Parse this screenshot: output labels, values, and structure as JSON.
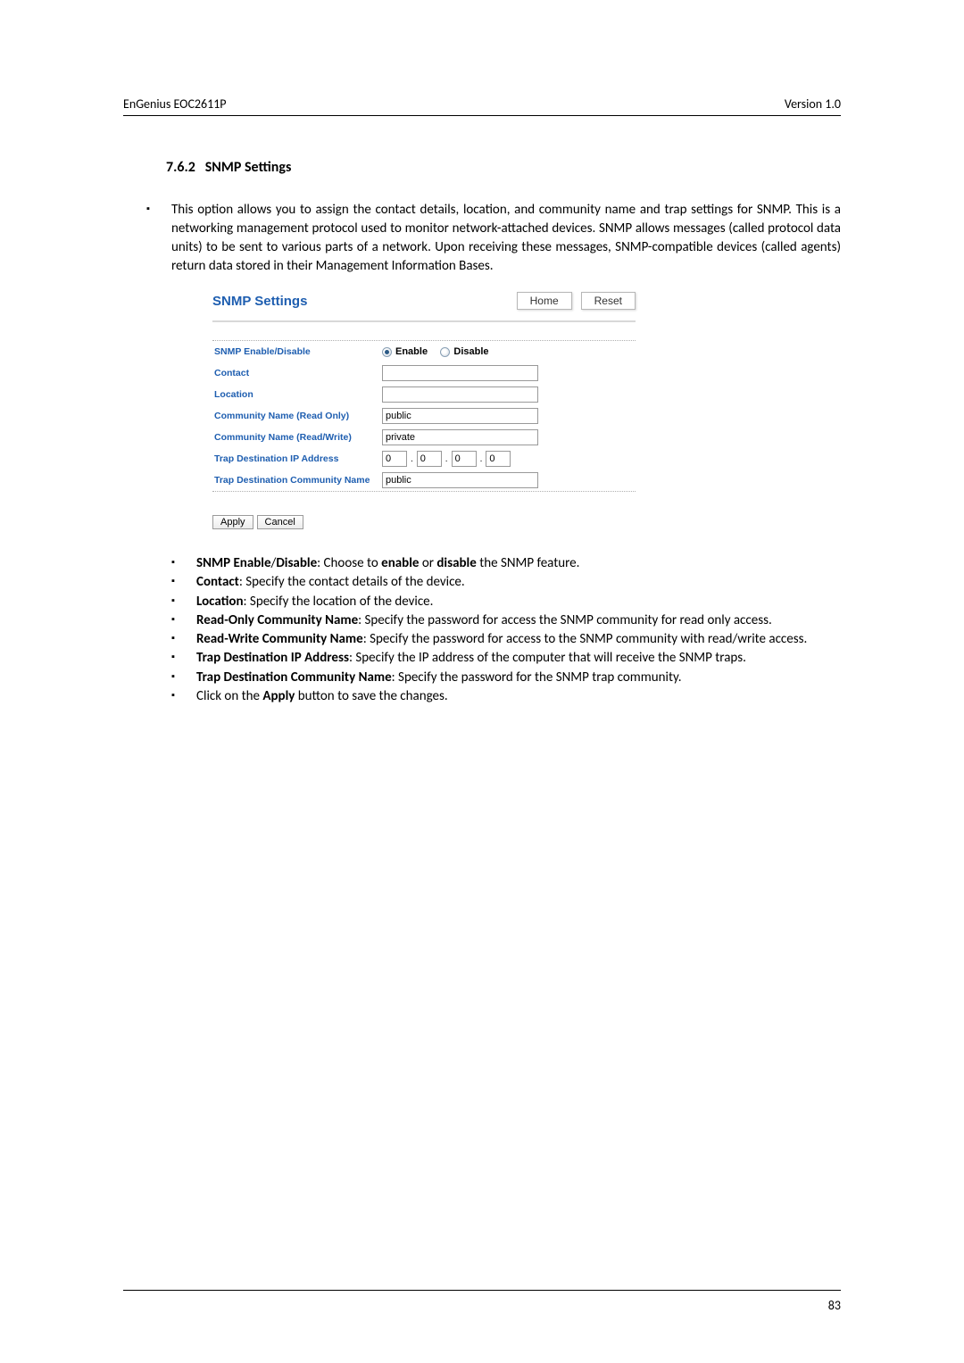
{
  "header": {
    "left": "EnGenius   EOC2611P",
    "right": "Version 1.0"
  },
  "section": {
    "number": "7.6.2",
    "title": "SNMP Settings"
  },
  "intro": "This option allows you to assign the contact details, location, and community name and trap settings for SNMP. This is a networking management protocol used to monitor network-attached devices. SNMP allows messages (called protocol data units) to be sent to various parts of a network. Upon receiving these messages, SNMP-compatible devices (called agents) return data stored in their Management Information Bases.",
  "screenshot": {
    "title": "SNMP Settings",
    "home": "Home",
    "reset": "Reset",
    "rows": {
      "enable_label": "SNMP Enable/Disable",
      "enable_opt": "Enable",
      "disable_opt": "Disable",
      "contact_label": "Contact",
      "contact_value": "",
      "location_label": "Location",
      "location_value": "",
      "cro_label": "Community Name (Read Only)",
      "cro_value": "public",
      "crw_label": "Community Name (Read/Write)",
      "crw_value": "private",
      "tdip_label": "Trap Destination IP Address",
      "tdip_oct1": "0",
      "tdip_oct2": "0",
      "tdip_oct3": "0",
      "tdip_oct4": "0",
      "tdcn_label": "Trap Destination Community Name",
      "tdcn_value": "public"
    },
    "apply": "Apply",
    "cancel": "Cancel"
  },
  "bullets": {
    "b1_bold": "SNMP Enable",
    "b1_sep": "/",
    "b1_bold2": "Disable",
    "b1_rest_a": ": Choose to ",
    "b1_enable": "enable",
    "b1_or": " or ",
    "b1_disable": "disable",
    "b1_rest_b": " the SNMP feature.",
    "b2_bold": "Contact",
    "b2_rest": ": Specify the contact details of the device.",
    "b3_bold": "Location",
    "b3_rest": ": Specify the location of the device.",
    "b4_bold": "Read-Only Community Name",
    "b4_rest": ": Specify the password for access the SNMP community for read only access.",
    "b5_bold": "Read-Write Community Name",
    "b5_rest": ": Specify the password for access to the SNMP community with read/write access.",
    "b6_bold": "Trap Destination IP Address",
    "b6_rest": ": Specify the IP address of the computer that will receive the SNMP traps.",
    "b7_bold": "Trap Destination Community Name",
    "b7_rest": ": Specify the password for the SNMP trap community.",
    "b8_a": "Click on the ",
    "b8_bold": "Apply",
    "b8_b": " button to save the changes."
  },
  "footer": {
    "page": "83"
  }
}
